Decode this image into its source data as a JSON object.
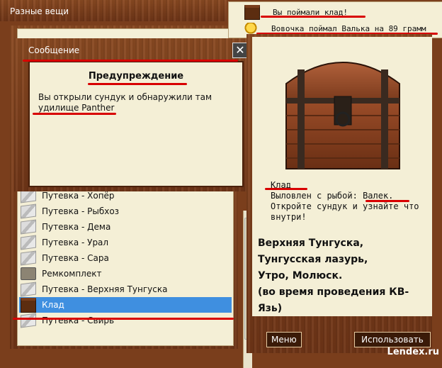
{
  "window": {
    "title": "Разные вещи"
  },
  "dialog": {
    "header": "Сообщение",
    "close_icon": "close-icon",
    "warning_title": "Предупреждение",
    "warning_text": "Вы открыли сундук и обнаружили там удилище Panther"
  },
  "list": {
    "items": [
      {
        "label": "Путевка - Хопёр",
        "icon": "voucher-icon"
      },
      {
        "label": "Путевка - Рыбхоз",
        "icon": "voucher-icon"
      },
      {
        "label": "Путевка - Дема",
        "icon": "voucher-icon"
      },
      {
        "label": "Путевка - Урал",
        "icon": "voucher-icon"
      },
      {
        "label": "Путевка - Сара",
        "icon": "voucher-icon"
      },
      {
        "label": "Ремкомплект",
        "icon": "repair-kit-icon"
      },
      {
        "label": "Путевка - Верхняя Тунгуска",
        "icon": "voucher-icon"
      },
      {
        "label": "Клад",
        "icon": "chest-icon",
        "selected": true
      },
      {
        "label": "Путевка - Свирь",
        "icon": "voucher-icon"
      }
    ],
    "selected_color": "#3f8fe0"
  },
  "notifications": [
    {
      "text": "Вы поймали клад!",
      "icon": "chest-icon"
    },
    {
      "text": "Вовочка поймал Валька на 89 грамм",
      "icon": "trophy-icon"
    }
  ],
  "details": {
    "name": "Клад",
    "caught_prefix": "Выловлен с рыбой:",
    "caught_fish": "Валек.",
    "instruction": "Откройте сундук и узнайте что внутри!",
    "locations_line1": "Верхняя Тунгуска,",
    "locations_line2": "Тунгусская лазурь,",
    "locations_line3": "Утро, Молюск.",
    "locations_line4": "(во время проведения КВ-Язь)"
  },
  "buttons": {
    "menu": "Меню",
    "use": "Использовать"
  },
  "watermark": "Lendex.ru",
  "colors": {
    "wood": "#7a3e1c",
    "cream": "#f4efd6",
    "highlight": "#d80000"
  }
}
